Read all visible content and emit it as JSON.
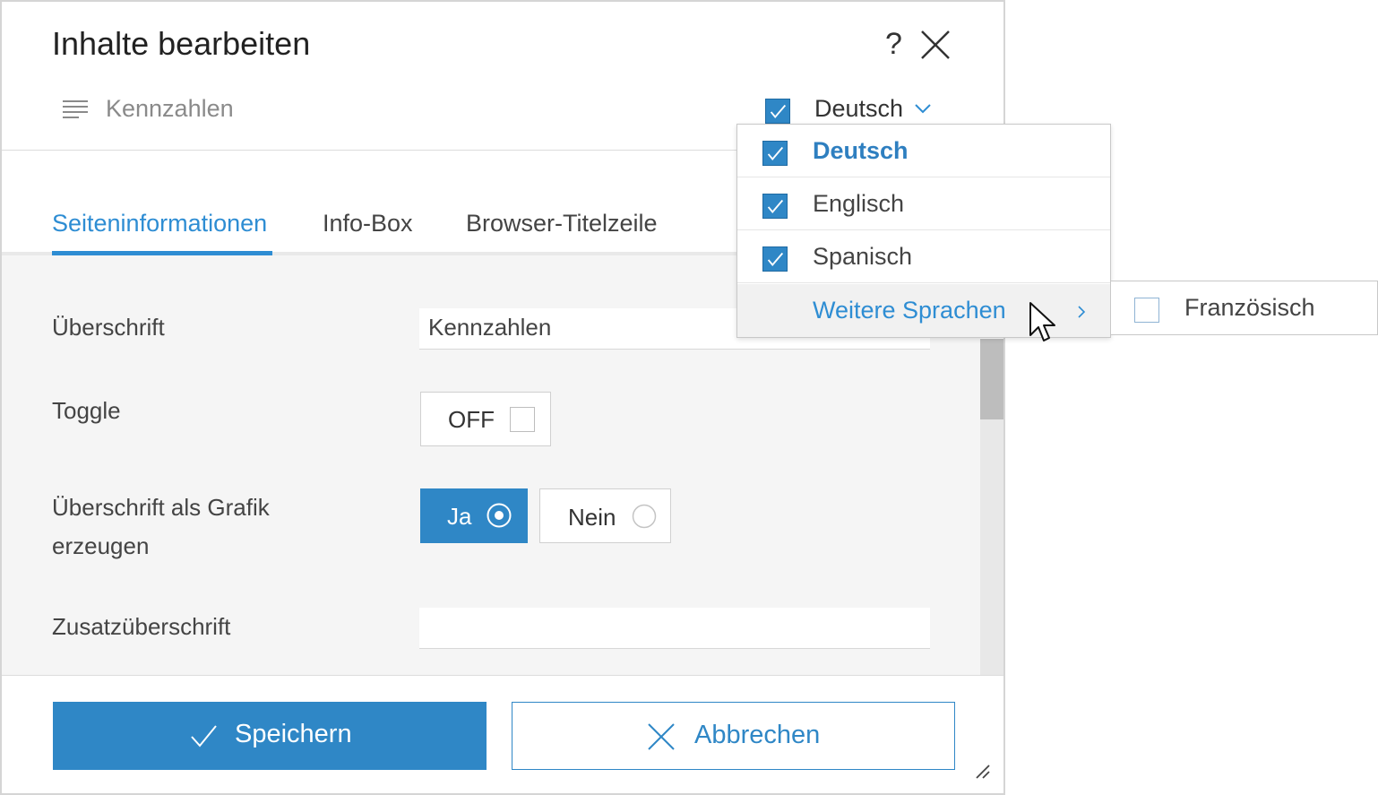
{
  "dialog": {
    "title": "Inhalte bearbeiten",
    "help_label": "?",
    "breadcrumb": "Kennzahlen",
    "language": {
      "selected": "Deutsch",
      "checked": true
    }
  },
  "tabs": [
    {
      "label": "Seiteninformationen",
      "active": true
    },
    {
      "label": "Info-Box",
      "active": false
    },
    {
      "label": "Browser-Titelzeile",
      "active": false
    }
  ],
  "form": {
    "heading": {
      "label": "Überschrift",
      "value": "Kennzahlen"
    },
    "toggle": {
      "label": "Toggle",
      "state_label": "OFF",
      "checked": false
    },
    "graphic": {
      "label_line1": "Überschrift als Grafik",
      "label_line2": "erzeugen",
      "options": [
        {
          "label": "Ja",
          "selected": true
        },
        {
          "label": "Nein",
          "selected": false
        }
      ]
    },
    "subheading": {
      "label": "Zusatzüberschrift",
      "value": ""
    }
  },
  "footer": {
    "save_label": "Speichern",
    "cancel_label": "Abbrechen"
  },
  "language_dropdown": {
    "items": [
      {
        "label": "Deutsch",
        "checked": true,
        "current": true
      },
      {
        "label": "Englisch",
        "checked": true,
        "current": false
      },
      {
        "label": "Spanisch",
        "checked": true,
        "current": false
      }
    ],
    "more_label": "Weitere Sprachen",
    "submenu": [
      {
        "label": "Französisch",
        "checked": false
      }
    ]
  },
  "colors": {
    "accent": "#2f87c6",
    "tab_active": "#2e8dd3",
    "panel_background": "#f5f5f5"
  },
  "icons": {
    "close": "close-icon",
    "breadcrumb": "lines-icon",
    "dropdown": "chevron-down-icon",
    "submenu": "chevron-right-icon",
    "save": "check-icon",
    "cancel": "x-icon",
    "resize": "resize-handle-icon",
    "cursor": "mouse-pointer-icon"
  }
}
